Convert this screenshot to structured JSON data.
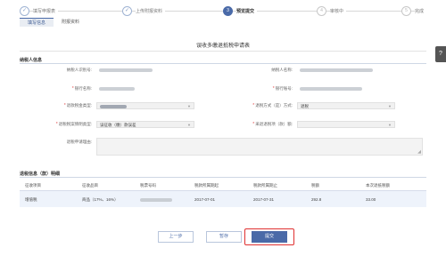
{
  "stepper": {
    "steps": [
      {
        "label": "填写申报表",
        "state": "done",
        "mark": "✓"
      },
      {
        "label": "上传附报资料",
        "state": "done",
        "mark": "✓"
      },
      {
        "label": "预览提交",
        "state": "active",
        "mark": "3"
      },
      {
        "label": "审核中",
        "state": "todo",
        "mark": "4"
      },
      {
        "label": "完成",
        "state": "todo",
        "mark": "5"
      }
    ]
  },
  "tabs": [
    {
      "label": "填写信息",
      "active": true
    },
    {
      "label": "附报资料",
      "active": false
    }
  ],
  "form": {
    "title": "误收多缴退抵税申请表",
    "taxpayer_section": "纳税人信息",
    "fields": {
      "taxpayer_id_label": "纳税人识别号:",
      "taxpayer_name_label": "纳税人名称:",
      "bank_label": "银行名称:",
      "account_label": "银行账号:",
      "refund_type_label": "退款税金类型:",
      "refund_type_value": "",
      "refund_method_label": "退税方式（是）方式:",
      "refund_method_value": "退税",
      "refund_reason_label": "退税税案情明类型:",
      "refund_reason_value": "误征收（缴）款误差",
      "source_label": "采退退税项（款）额:",
      "notes_label": "退税申请理由:"
    }
  },
  "table": {
    "section_title": "退税信息（款）明细",
    "headers": [
      "征收项目",
      "征收品目",
      "税票号码",
      "税款所属期起",
      "税款所属期止",
      "税额",
      "本次退抵税额"
    ],
    "rows": [
      [
        "增值税",
        "商品（17%、16%）",
        "",
        "2017-07-01",
        "2017-07-31",
        "292.8",
        "33.00"
      ]
    ]
  },
  "buttons": {
    "prev": "上一步",
    "save": "暂存",
    "submit": "提交"
  },
  "help_icon": "?"
}
